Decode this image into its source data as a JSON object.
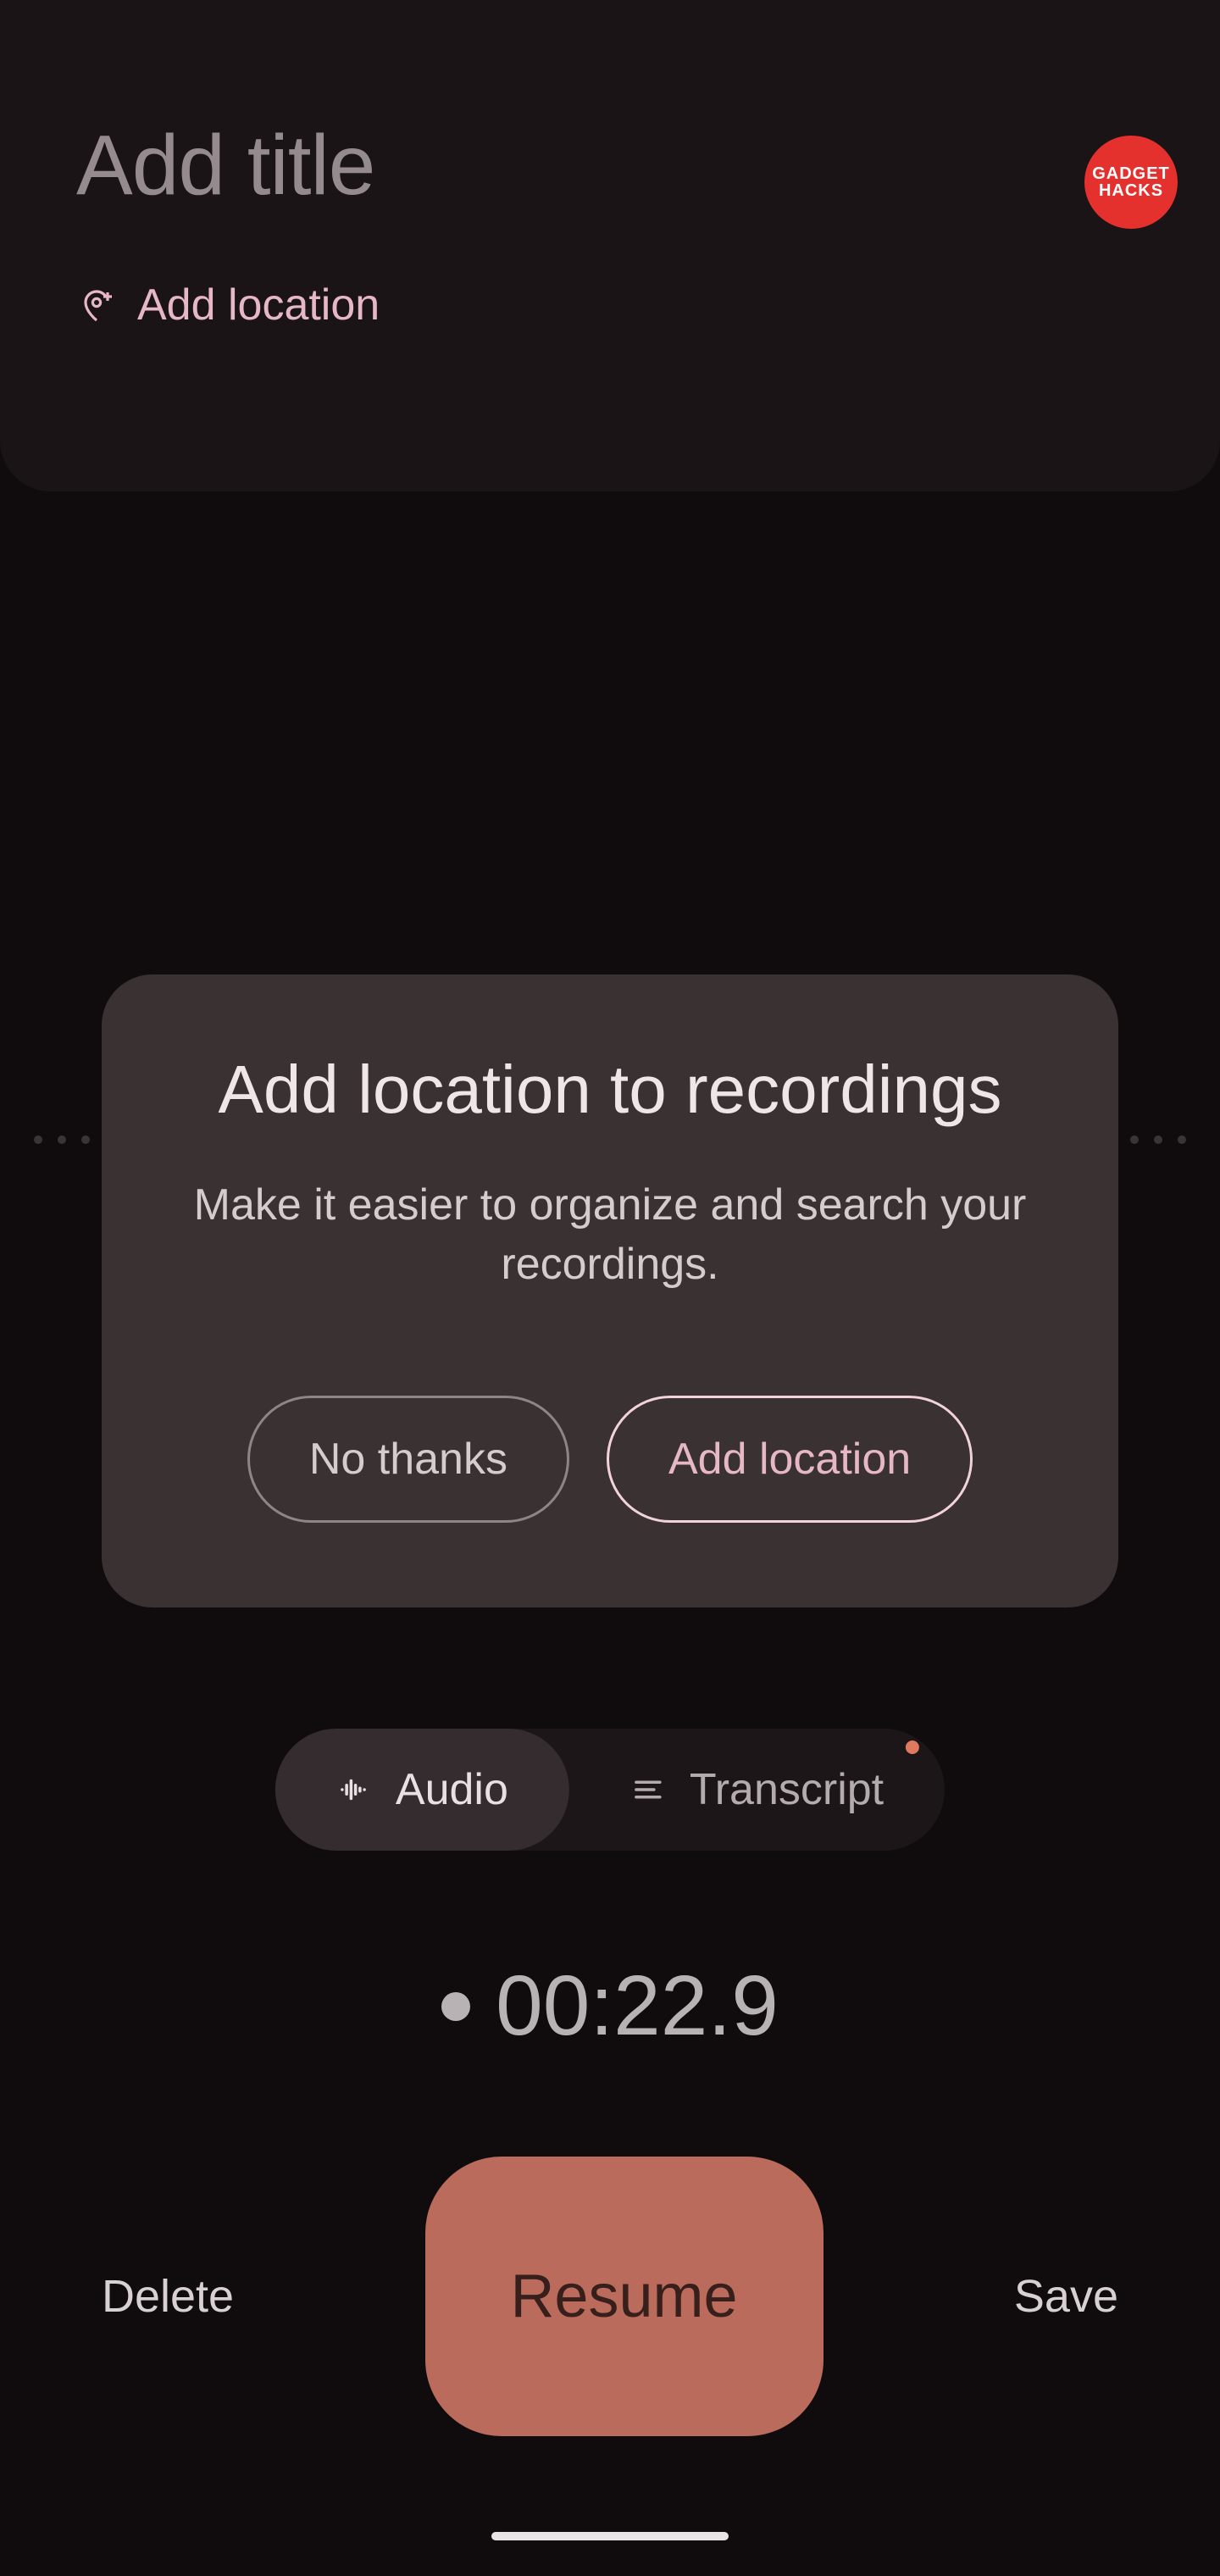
{
  "header": {
    "title_placeholder": "Add title",
    "add_location_label": "Add location"
  },
  "brand": {
    "line1": "GADGET",
    "line2": "HACKS"
  },
  "dialog": {
    "title": "Add location to recordings",
    "body": "Make it easier to organize and search your recordings.",
    "negative_label": "No thanks",
    "positive_label": "Add location"
  },
  "segmented": {
    "audio_label": "Audio",
    "transcript_label": "Transcript"
  },
  "timer": {
    "value": "00:22.9"
  },
  "controls": {
    "delete_label": "Delete",
    "resume_label": "Resume",
    "save_label": "Save"
  },
  "icons": {
    "add_location": "add-location-icon",
    "waveform": "waveform-icon",
    "lines": "lines-icon"
  }
}
